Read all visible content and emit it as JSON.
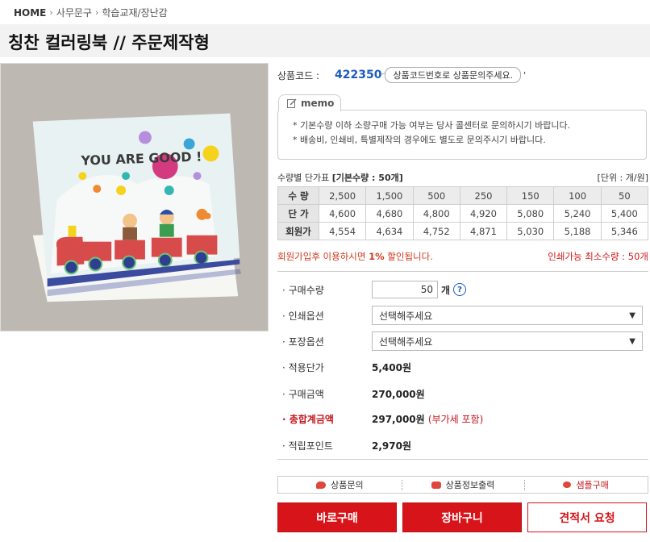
{
  "breadcrumb": {
    "home": "HOME",
    "cat1": "사무문구",
    "cat2": "학습교재/장난감"
  },
  "product": {
    "title": "칭찬 컬러링북 // 주문제작형",
    "image_text": "YOU ARE GOOD !",
    "code_label": "상품코드 :",
    "code": "422350",
    "code_note": "상품코드번호로 상품문의주세요.",
    "code_tick": "'"
  },
  "memo": {
    "tab": "memo",
    "lines": [
      "* 기본수량 이하 소량구매 가능 여부는 당사 콜센터로 문의하시기 바랍니다.",
      "* 배송비, 인쇄비, 특별제작의 경우에도 별도로 문의주시기 바랍니다."
    ]
  },
  "price_table": {
    "title_prefix": "수량별 단가표 ",
    "title_bold": "[기본수량 : 50개]",
    "unit": "[단위 : 개/원]",
    "rows": [
      {
        "label": "수 량",
        "values": [
          "2,500",
          "1,500",
          "500",
          "250",
          "150",
          "100",
          "50"
        ]
      },
      {
        "label": "단 가",
        "values": [
          "4,600",
          "4,680",
          "4,800",
          "4,920",
          "5,080",
          "5,240",
          "5,400"
        ]
      },
      {
        "label": "회원가",
        "values": [
          "4,554",
          "4,634",
          "4,752",
          "4,871",
          "5,030",
          "5,188",
          "5,346"
        ]
      }
    ]
  },
  "discount": {
    "prefix": "회원가입후 이용하시면 ",
    "percent": "1%",
    "suffix": " 할인됩니다.",
    "min_qty": "인쇄가능 최소수량 : 50개"
  },
  "options": {
    "qty_label": "· 구매수량",
    "qty_value": "50",
    "qty_unit": "개",
    "help": "?",
    "print_label": "· 인쇄옵션",
    "print_value": "선택해주세요",
    "pack_label": "· 포장옵션",
    "pack_value": "선택해주세요",
    "unit_price_label": "· 적용단가",
    "unit_price": "5,400원",
    "amount_label": "· 구매금액",
    "amount": "270,000원",
    "total_label": "· 총합계금액",
    "total": "297,000원",
    "vat": "(부가세 포함)",
    "points_label": "· 적립포인트",
    "points": "2,970원"
  },
  "links": {
    "inquiry": "상품문의",
    "print_info": "상품정보출력",
    "sample": "샘플구매"
  },
  "buttons": {
    "buy": "바로구매",
    "cart": "장바구니",
    "quote": "견적서 요청"
  },
  "colors": {
    "accent": "#d71419",
    "code": "#1d5bbf",
    "discount": "#d23a1d"
  }
}
